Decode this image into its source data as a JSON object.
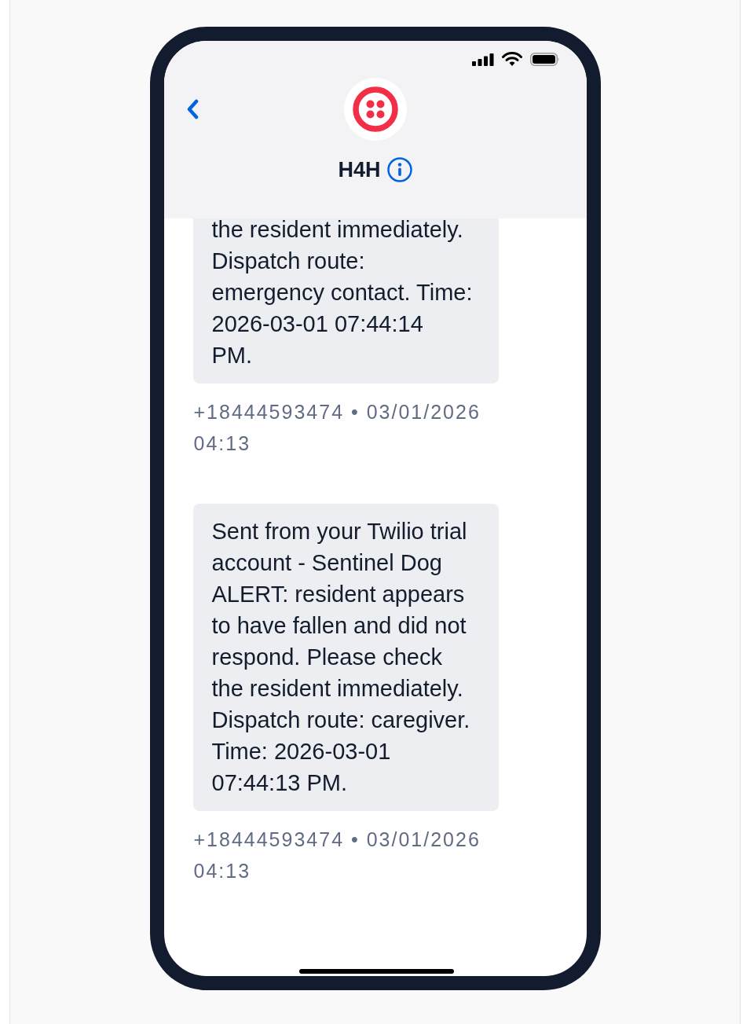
{
  "contact": {
    "name": "H4H"
  },
  "messages": [
    {
      "text": "the resident immediately.\nDispatch route:\nemergency contact. Time:\n2026-03-01 07:44:14\nPM.",
      "meta": "+18444593474 • 03/01/2026 04:13"
    },
    {
      "text": "Sent from your Twilio trial\naccount - Sentinel Dog\nALERT: resident appears\nto have fallen and did not\nrespond. Please check\nthe resident immediately.\nDispatch route: caregiver.\nTime: 2026-03-01\n07:44:13 PM.",
      "meta": "+18444593474 • 03/01/2026 04:13"
    }
  ]
}
